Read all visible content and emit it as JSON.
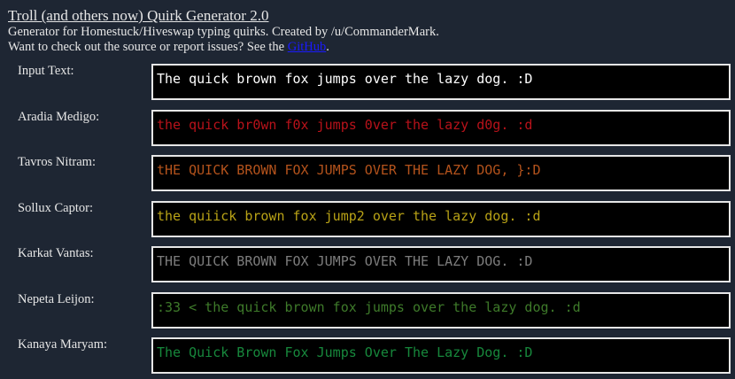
{
  "header": {
    "title": "Troll (and others now) Quirk Generator 2.0",
    "line1": "Generator for Homestuck/Hiveswap typing quirks. Created by /u/CommanderMark.",
    "line2_prefix": "Want to check out the source or report issues? See the ",
    "github_link": "GitHub",
    "line2_suffix": "."
  },
  "input": {
    "label": "Input Text:",
    "value": "The quick brown fox jumps over the lazy dog. :D",
    "color": "#ffffff"
  },
  "trolls": [
    {
      "label": "Aradia Medigo:",
      "text": "the quick br0wn f0x jumps 0ver the lazy d0g. :d",
      "color": "#b8121a"
    },
    {
      "label": "Tavros Nitram:",
      "text": "tHE QUICK BROWN FOX JUMPS OVER THE LAZY DOG, }:D",
      "color": "#b4531c"
    },
    {
      "label": "Sollux Captor:",
      "text": "the quiick brown fox jump2 over the lazy dog. :d",
      "color": "#b8a216"
    },
    {
      "label": "Karkat Vantas:",
      "text": "THE QUICK BROWN FOX JUMPS OVER THE LAZY DOG. :D",
      "color": "#7d7d7d"
    },
    {
      "label": "Nepeta Leijon:",
      "text": ":33 < the quick brown fox jumps over the lazy dog. :d",
      "color": "#3e7a2a"
    },
    {
      "label": "Kanaya Maryam:",
      "text": "The Quick Brown Fox Jumps Over The Lazy Dog. :D",
      "color": "#17883c"
    }
  ]
}
